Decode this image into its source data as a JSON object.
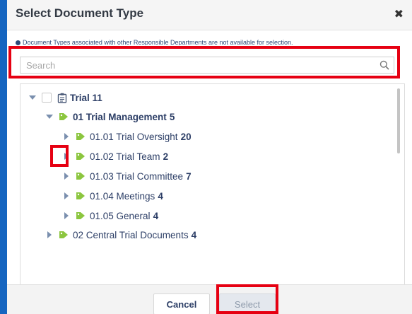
{
  "dialog": {
    "title": "Select Document Type",
    "close_glyph": "✖",
    "notice": "Document Types associated with other Responsible Departments are not available for selection.",
    "search": {
      "placeholder": "Search",
      "value": ""
    }
  },
  "tree": {
    "root": {
      "label": "Trial 11",
      "icon": "clipboard-icon"
    },
    "management": {
      "label": "01 Trial Management",
      "count": "5"
    },
    "children": [
      {
        "label": "01.01 Trial Oversight",
        "count": "20"
      },
      {
        "label": "01.02 Trial Team",
        "count": "2"
      },
      {
        "label": "01.03 Trial Committee",
        "count": "7"
      },
      {
        "label": "01.04 Meetings",
        "count": "4"
      },
      {
        "label": "01.05 General",
        "count": "4"
      }
    ],
    "central": {
      "label": "02 Central Trial Documents",
      "count": "4"
    }
  },
  "footer": {
    "cancel_label": "Cancel",
    "select_label": "Select"
  },
  "colors": {
    "outer_frame": "#1565c0",
    "highlight": "#e60012",
    "tag_green": "#8cc63f",
    "tree_text": "#2c3e66",
    "toggle_arrow": "#7a8fae"
  }
}
